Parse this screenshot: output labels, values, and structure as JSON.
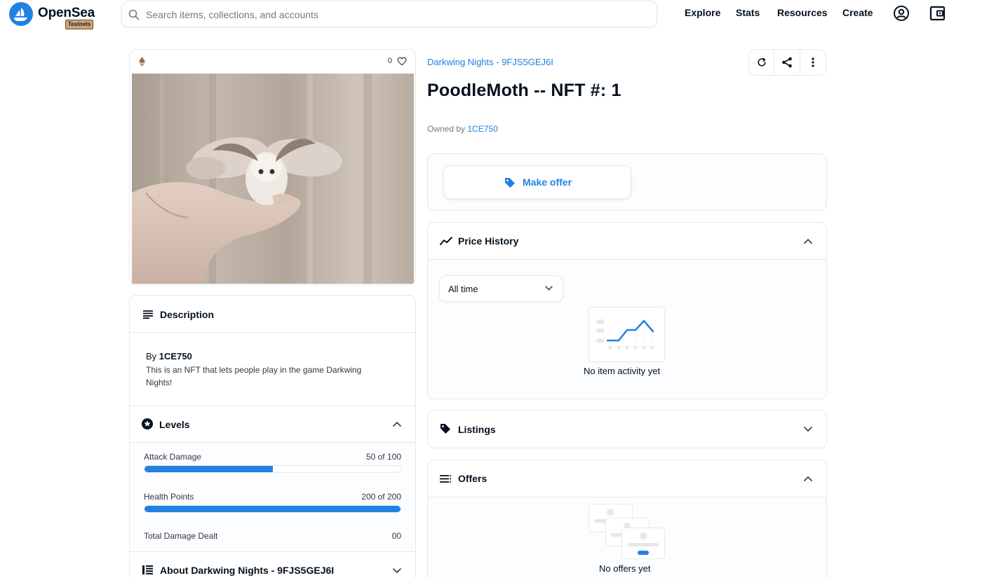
{
  "header": {
    "brand": "OpenSea",
    "badge": "Testnets",
    "search_placeholder": "Search items, collections, and accounts",
    "nav": [
      "Explore",
      "Stats",
      "Resources",
      "Create"
    ],
    "icons": [
      "profile-icon",
      "wallet-icon"
    ]
  },
  "item": {
    "like_count": "0",
    "collection": "Darkwing Nights - 9FJS5GEJ6I",
    "title": "PoodleMoth -- NFT #: 1",
    "owned_by_label": "Owned by",
    "owner": "1CE750",
    "image_alt": "poodle moth on hand"
  },
  "offer": {
    "label": "Make offer"
  },
  "price_history": {
    "title": "Price History",
    "period": "All time",
    "empty": "No item activity yet"
  },
  "listings": {
    "title": "Listings"
  },
  "offers": {
    "title": "Offers",
    "empty": "No offers yet"
  },
  "description": {
    "title": "Description",
    "by_label": "By",
    "creator": "1CE750",
    "text": "This is an NFT that lets people play in the game Darkwing Nights!"
  },
  "levels": {
    "title": "Levels",
    "items": [
      {
        "label": "Attack Damage",
        "value": "50 of 100",
        "fraction": 0.5
      },
      {
        "label": "Health Points",
        "value": "200 of 200",
        "fraction": 1.0
      },
      {
        "label": "Total Damage Dealt",
        "value": "00"
      }
    ]
  },
  "about": {
    "title": "About Darkwing Nights - 9FJS5GEJ6I"
  },
  "colors": {
    "accent": "#2081e2",
    "border": "#e5e8eb",
    "text": "#04111d",
    "muted": "#707a83"
  }
}
